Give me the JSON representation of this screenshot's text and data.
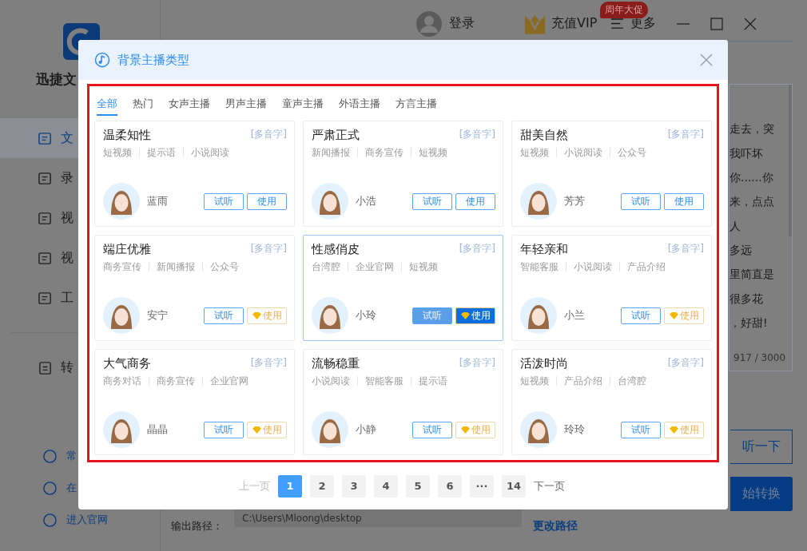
{
  "app": {
    "name": "迅捷文",
    "nav": [
      {
        "label": "文",
        "selected": true
      },
      {
        "label": "录",
        "selected": false
      },
      {
        "label": "视",
        "selected": false
      },
      {
        "label": "视",
        "selected": false
      },
      {
        "label": "工",
        "selected": false
      }
    ],
    "tools": [
      {
        "label": "转"
      }
    ],
    "links": [
      {
        "label": "常"
      },
      {
        "label": "在"
      },
      {
        "label": "进入官网"
      }
    ],
    "header": {
      "login": "登录",
      "vip": "充值VIP",
      "promo_badge": "周年大促",
      "more": "更多"
    },
    "text_lines": [
      "走去，突",
      "我吓坏",
      "你......你",
      "来，点点",
      "人",
      "多远",
      "里简直是",
      "很多花",
      "，好甜!"
    ],
    "counter": "917 / 3000",
    "preview_button": "听一下",
    "convert_button": "始转换",
    "output_label": "输出路径：",
    "output_path": "C:\\Users\\Mloong\\desktop",
    "change_path": "更改路径"
  },
  "dialog": {
    "title": "背景主播类型",
    "tabs": [
      {
        "label": "全部",
        "selected": true
      },
      {
        "label": "热门",
        "selected": false
      },
      {
        "label": "女声主播",
        "selected": false
      },
      {
        "label": "男声主播",
        "selected": false
      },
      {
        "label": "童声主播",
        "selected": false
      },
      {
        "label": "外语主播",
        "selected": false
      },
      {
        "label": "方言主播",
        "selected": false
      }
    ],
    "voices": [
      {
        "title": "温柔知性",
        "badge": "[多音字]",
        "tags": [
          "短视频",
          "提示语",
          "小说阅读"
        ],
        "name": "蓝雨",
        "listen": "试听",
        "use": "使用",
        "vip": false,
        "selected": false
      },
      {
        "title": "严肃正式",
        "badge": "[多音字]",
        "tags": [
          "新闻播报",
          "商务宣传",
          "短视频"
        ],
        "name": "小浩",
        "listen": "试听",
        "use": "使用",
        "vip": false,
        "selected": false
      },
      {
        "title": "甜美自然",
        "badge": "[多音字]",
        "tags": [
          "短视频",
          "小说阅读",
          "公众号"
        ],
        "name": "芳芳",
        "listen": "试听",
        "use": "使用",
        "vip": false,
        "selected": false
      },
      {
        "title": "端庄优雅",
        "badge": "[多音字]",
        "tags": [
          "商务宣传",
          "新闻播报",
          "公众号"
        ],
        "name": "安宁",
        "listen": "试听",
        "use": "使用",
        "vip": true,
        "selected": false
      },
      {
        "title": "性感俏皮",
        "badge": "[多音字]",
        "tags": [
          "台湾腔",
          "企业官网",
          "短视频"
        ],
        "name": "小玲",
        "listen": "试听",
        "use": "使用",
        "vip": true,
        "selected": true
      },
      {
        "title": "年轻亲和",
        "badge": "[多音字]",
        "tags": [
          "智能客服",
          "小说阅读",
          "产品介绍"
        ],
        "name": "小兰",
        "listen": "试听",
        "use": "使用",
        "vip": true,
        "selected": false
      },
      {
        "title": "大气商务",
        "badge": "[多音字]",
        "tags": [
          "商务对话",
          "商务宣传",
          "企业官网"
        ],
        "name": "晶晶",
        "listen": "试听",
        "use": "使用",
        "vip": true,
        "selected": false
      },
      {
        "title": "流畅稳重",
        "badge": "[多音字]",
        "tags": [
          "小说阅读",
          "智能客服",
          "提示语"
        ],
        "name": "小静",
        "listen": "试听",
        "use": "使用",
        "vip": true,
        "selected": false
      },
      {
        "title": "活泼时尚",
        "badge": "[多音字]",
        "tags": [
          "短视频",
          "产品介绍",
          "台湾腔"
        ],
        "name": "玲玲",
        "listen": "试听",
        "use": "使用",
        "vip": true,
        "selected": false
      }
    ],
    "pagination": {
      "prev": {
        "label": "上一页",
        "disabled": true
      },
      "pages": [
        {
          "label": "1",
          "selected": true
        },
        {
          "label": "2",
          "selected": false
        },
        {
          "label": "3",
          "selected": false
        },
        {
          "label": "4",
          "selected": false
        },
        {
          "label": "5",
          "selected": false
        },
        {
          "label": "6",
          "selected": false
        },
        {
          "label": "···",
          "selected": false
        },
        {
          "label": "14",
          "selected": false
        }
      ],
      "next": {
        "label": "下一页",
        "disabled": false
      }
    }
  }
}
